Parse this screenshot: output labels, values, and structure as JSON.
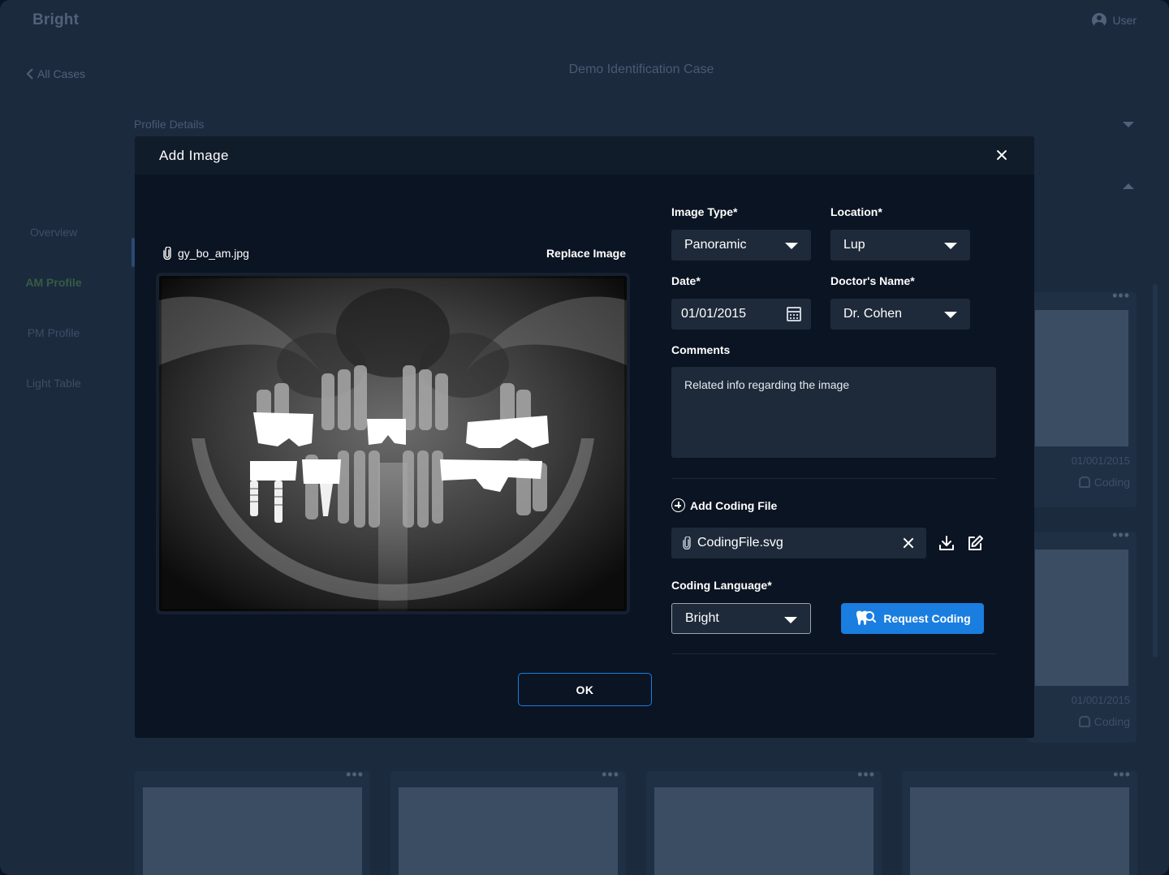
{
  "app": {
    "logo": "Bright",
    "user_label": "User",
    "back_label": "All Cases",
    "page_title": "Demo Identification Case",
    "profile_details_label": "Profile Details",
    "sidebar": [
      {
        "label": "Overview",
        "active": false
      },
      {
        "label": "AM Profile",
        "active": true
      },
      {
        "label": "PM Profile",
        "active": false
      },
      {
        "label": "Light Table",
        "active": false
      }
    ],
    "cards": [
      {
        "date": "01/001/2015",
        "coding_label": "Coding"
      },
      {
        "date": "01/001/2015",
        "coding_label": "Coding"
      }
    ]
  },
  "modal": {
    "title": "Add Image",
    "file_name": "gy_bo_am.jpg",
    "replace_label": "Replace Image",
    "image_type": {
      "label": "Image Type*",
      "value": "Panoramic"
    },
    "location": {
      "label": "Location*",
      "value": "Lup"
    },
    "date": {
      "label": "Date*",
      "value": "01/01/2015"
    },
    "doctor": {
      "label": "Doctor's Name*",
      "value": "Dr. Cohen"
    },
    "comments": {
      "label": "Comments",
      "value": "Related info regarding the image"
    },
    "add_coding_label": "Add Coding File",
    "coding_file_name": "CodingFile.svg",
    "coding_language": {
      "label": "Coding Language*",
      "value": "Bright"
    },
    "request_coding_label": "Request Coding",
    "ok_label": "OK"
  },
  "colors": {
    "accent": "#1a7de0",
    "modal_bg": "#0b1422",
    "field_bg": "#1e2a3a",
    "app_bg": "#1b2a3d"
  }
}
